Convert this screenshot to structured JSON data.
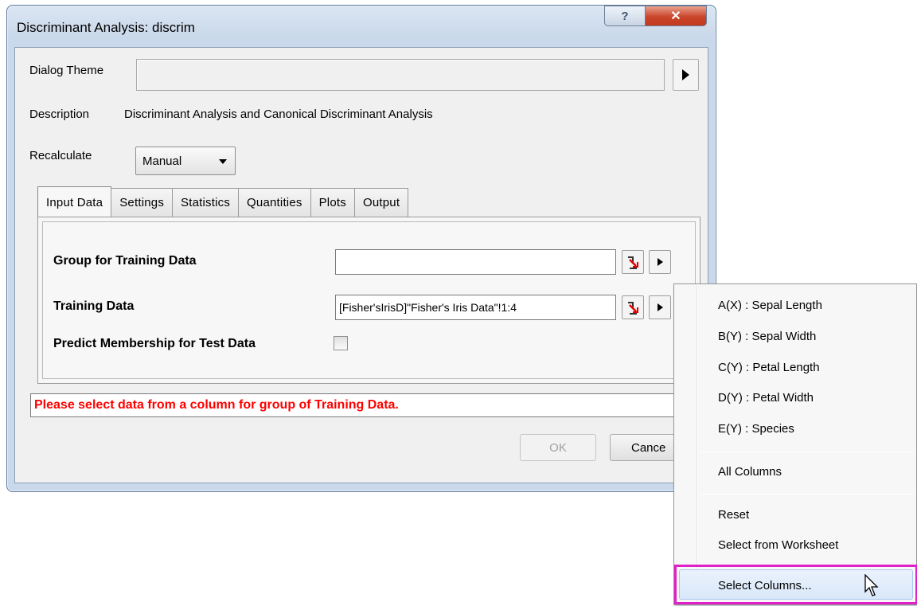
{
  "window": {
    "title": "Discriminant Analysis: discrim",
    "help_glyph": "?",
    "close_glyph": "✕"
  },
  "form": {
    "dialog_theme_label": "Dialog Theme",
    "dialog_theme_value": "",
    "description_label": "Description",
    "description_value": "Discriminant Analysis and Canonical Discriminant Analysis",
    "recalculate_label": "Recalculate",
    "recalculate_value": "Manual"
  },
  "tabs": [
    {
      "label": "Input Data",
      "active": true
    },
    {
      "label": "Settings"
    },
    {
      "label": "Statistics"
    },
    {
      "label": "Quantities"
    },
    {
      "label": "Plots"
    },
    {
      "label": "Output"
    }
  ],
  "input_data": {
    "group_label": "Group for Training Data",
    "group_value": "",
    "training_label": "Training Data",
    "training_value": "[Fisher'sIrisD]\"Fisher's Iris Data\"!1:4",
    "predict_label": "Predict Membership for Test Data",
    "predict_checked": false
  },
  "status": {
    "error": "Please select data from a column for group of Training Data."
  },
  "buttons": {
    "ok": "OK",
    "cancel": "Cance"
  },
  "context_menu": {
    "columns": [
      "A(X) : Sepal Length",
      "B(Y) : Sepal Width",
      "C(Y) : Petal Length",
      "D(Y) : Petal Width",
      "E(Y) : Species"
    ],
    "all_columns": "All Columns",
    "reset": "Reset",
    "select_from_worksheet": "Select from Worksheet",
    "select_columns": "Select Columns..."
  },
  "colors": {
    "error_text": "#ff0000",
    "highlight_border": "#e020c8"
  }
}
